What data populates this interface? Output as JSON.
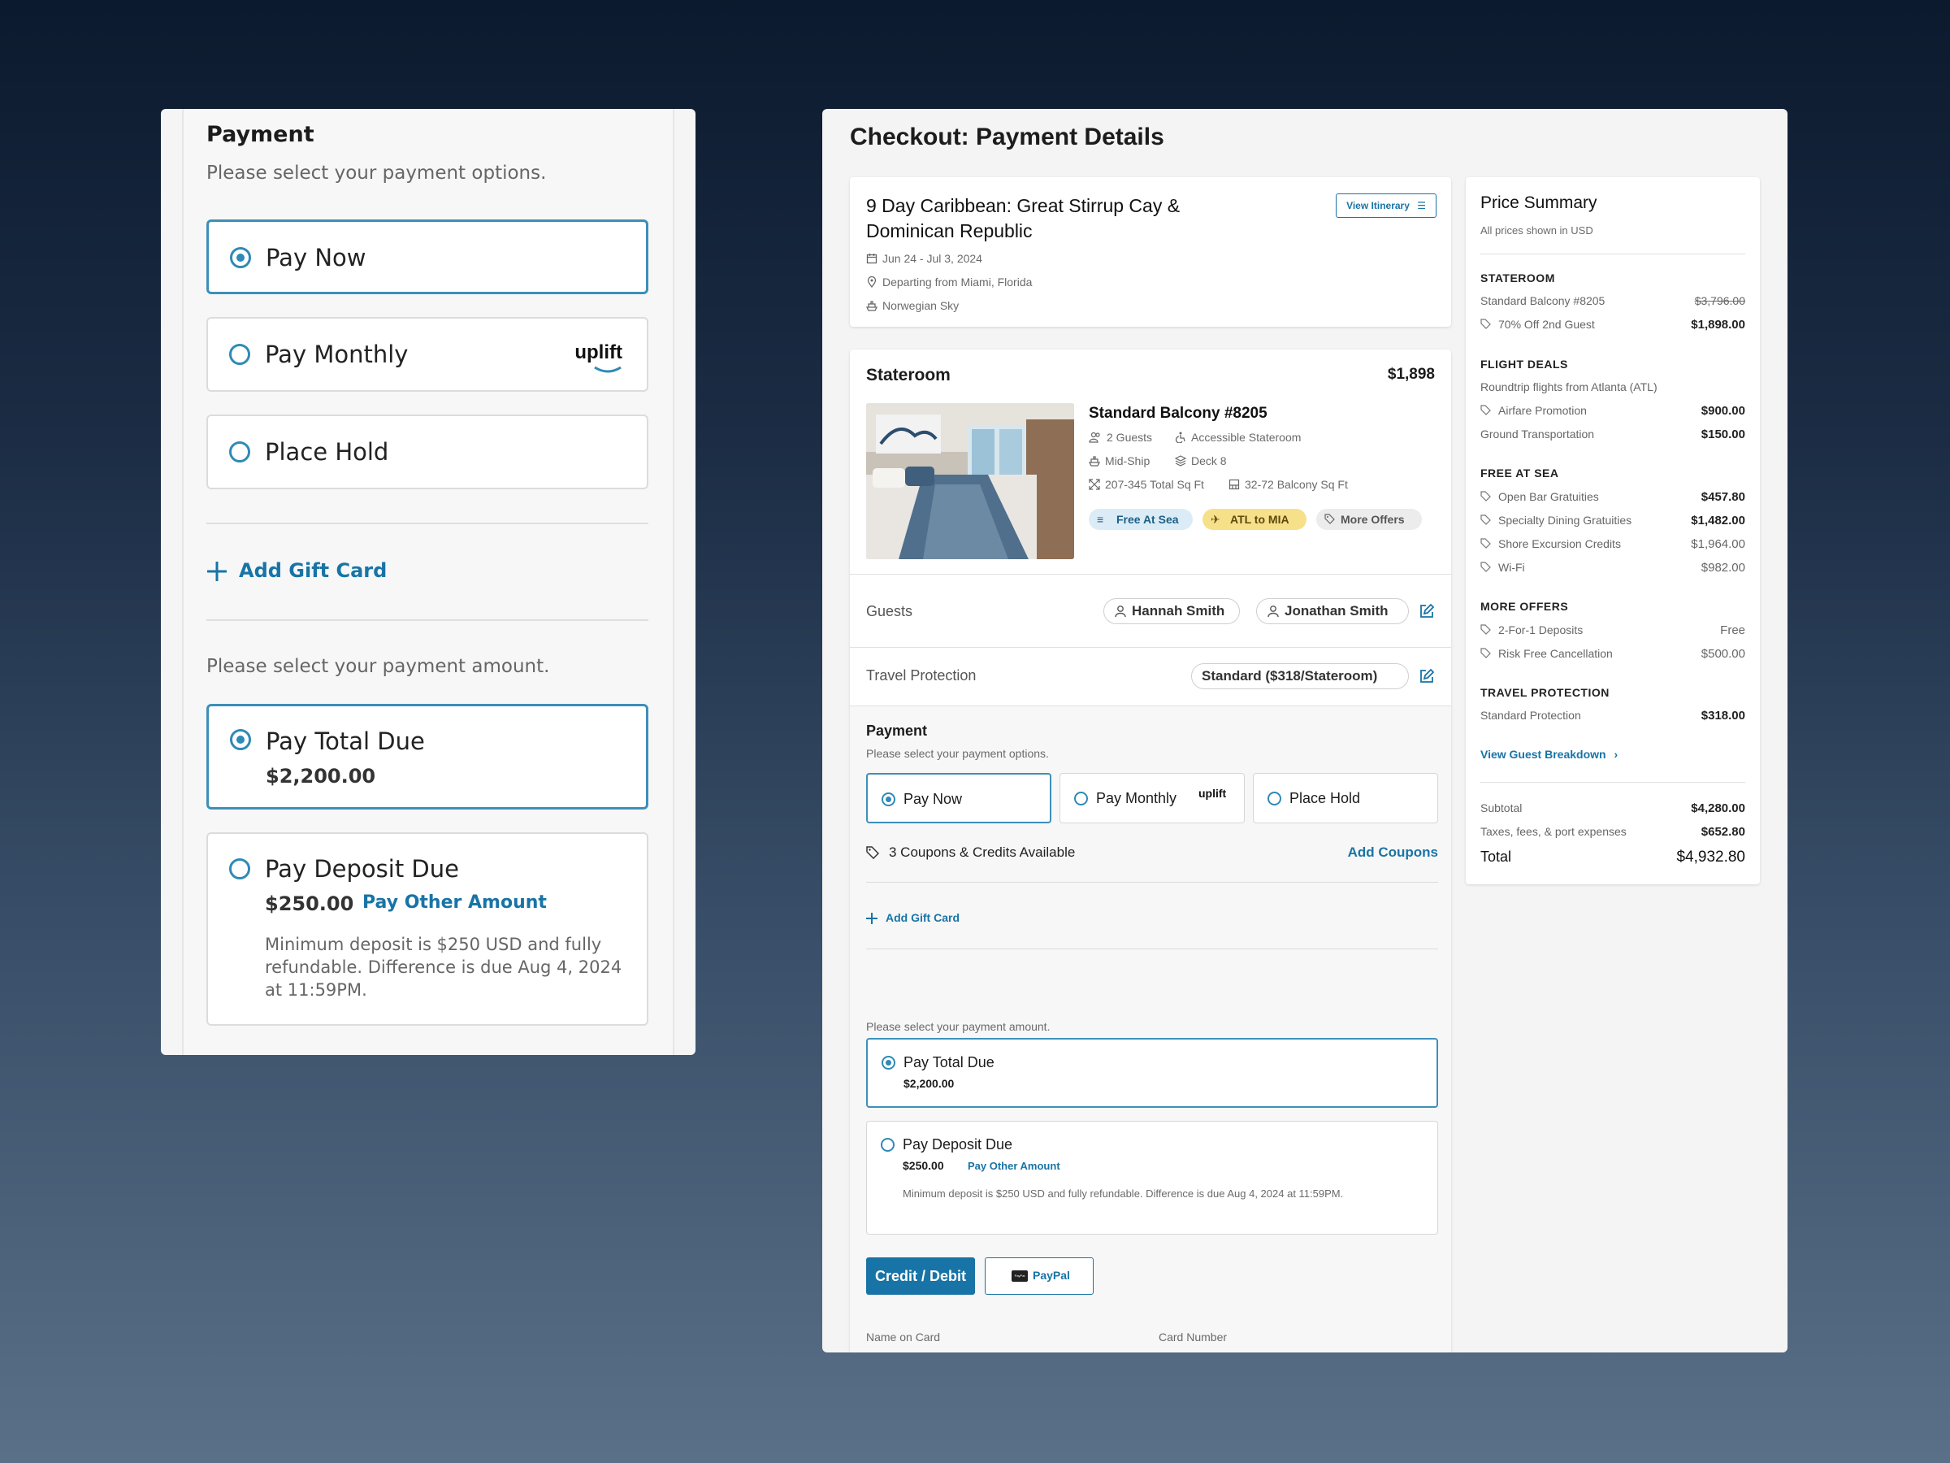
{
  "left_panel": {
    "title": "Payment",
    "subtitle": "Please select your payment options.",
    "options": [
      {
        "label": "Pay Now",
        "selected": true
      },
      {
        "label": "Pay Monthly",
        "selected": false,
        "badge": "uplift"
      },
      {
        "label": "Place Hold",
        "selected": false
      }
    ],
    "add_gift_card": "Add Gift Card",
    "amount_prompt": "Please select your payment amount.",
    "total_due": {
      "label": "Pay Total Due",
      "amount": "$2,200.00",
      "selected": true
    },
    "deposit_due": {
      "label": "Pay Deposit Due",
      "amount": "$250.00",
      "link": "Pay Other Amount",
      "note": "Minimum deposit is $250 USD and fully refundable. Difference is due Aug 4, 2024 at 11:59PM.",
      "selected": false
    }
  },
  "checkout": {
    "title": "Checkout: Payment Details",
    "trip": {
      "title": "9 Day Caribbean: Great Stirrup Cay & Dominican Republic",
      "dates": "Jun 24 - Jul 3, 2024",
      "departure": "Departing from Miami, Florida",
      "ship": "Norwegian Sky",
      "view_itinerary": "View Itinerary"
    },
    "stateroom": {
      "heading": "Stateroom",
      "price": "$1,898",
      "name": "Standard Balcony #8205",
      "guests": "2 Guests",
      "accessible": "Accessible Stateroom",
      "location": "Mid-Ship",
      "deck": "Deck 8",
      "total_sqft": "207-345 Total Sq Ft",
      "balcony_sqft": "32-72 Balcony Sq Ft",
      "tags": [
        "Free At Sea",
        "ATL to MIA",
        "More Offers"
      ]
    },
    "guests": {
      "label": "Guests",
      "names": [
        "Hannah Smith",
        "Jonathan Smith"
      ]
    },
    "travel_protection": {
      "label": "Travel Protection",
      "value": "Standard ($318/Stateroom)"
    },
    "payment": {
      "title": "Payment",
      "subtitle": "Please select your payment options.",
      "options": [
        "Pay Now",
        "Pay Monthly",
        "Place Hold"
      ],
      "uplift": "uplift",
      "coupons_text": "3 Coupons & Credits Available",
      "add_coupons": "Add Coupons",
      "add_gift_card": "Add Gift Card",
      "amount_prompt": "Please select your payment amount.",
      "total_due_label": "Pay Total Due",
      "total_due_amount": "$2,200.00",
      "deposit_label": "Pay Deposit Due",
      "deposit_amount": "$250.00",
      "pay_other": "Pay Other Amount",
      "deposit_note": "Minimum deposit is $250 USD and fully refundable. Difference is due Aug 4, 2024 at 11:59PM.",
      "credit_debit": "Credit / Debit",
      "paypal": "PayPal",
      "paypal_mini": "PayPal",
      "name_on_card": "Name on Card",
      "card_number": "Card Number"
    },
    "price_summary": {
      "title": "Price Summary",
      "subtitle": "All prices shown in USD",
      "stateroom_head": "STATEROOM",
      "stateroom_item": "Standard Balcony #8205",
      "stateroom_orig": "$3,796.00",
      "discount_label": "70% Off 2nd Guest",
      "discount_value": "$1,898.00",
      "flight_head": "FLIGHT DEALS",
      "flight_desc": "Roundtrip flights from Atlanta (ATL)",
      "airfare_label": "Airfare Promotion",
      "airfare_value": "$900.00",
      "ground_label": "Ground Transportation",
      "ground_value": "$150.00",
      "fas_head": "FREE AT SEA",
      "open_bar_label": "Open Bar Gratuities",
      "open_bar_value": "$457.80",
      "dining_label": "Specialty Dining Gratuities",
      "dining_value": "$1,482.00",
      "shore_label": "Shore Excursion Credits",
      "shore_value": "$1,964.00",
      "wifi_label": "Wi-Fi",
      "wifi_value": "$982.00",
      "more_head": "MORE OFFERS",
      "deposits_label": "2-For-1 Deposits",
      "deposits_value": "Free",
      "cancel_label": "Risk Free Cancellation",
      "cancel_value": "$500.00",
      "tp_head": "TRAVEL PROTECTION",
      "tp_label": "Standard Protection",
      "tp_value": "$318.00",
      "guest_breakdown": "View Guest Breakdown",
      "subtotal_label": "Subtotal",
      "subtotal_value": "$4,280.00",
      "taxes_label": "Taxes, fees, & port expenses",
      "taxes_value": "$652.80",
      "total_label": "Total",
      "total_value": "$4,932.80"
    }
  },
  "colors": {
    "accent": "#1874a6",
    "radio": "#2f8ab6",
    "tag_blue": "#dcecf6",
    "tag_yellow": "#f7e08a",
    "tag_gray": "#ececec"
  }
}
